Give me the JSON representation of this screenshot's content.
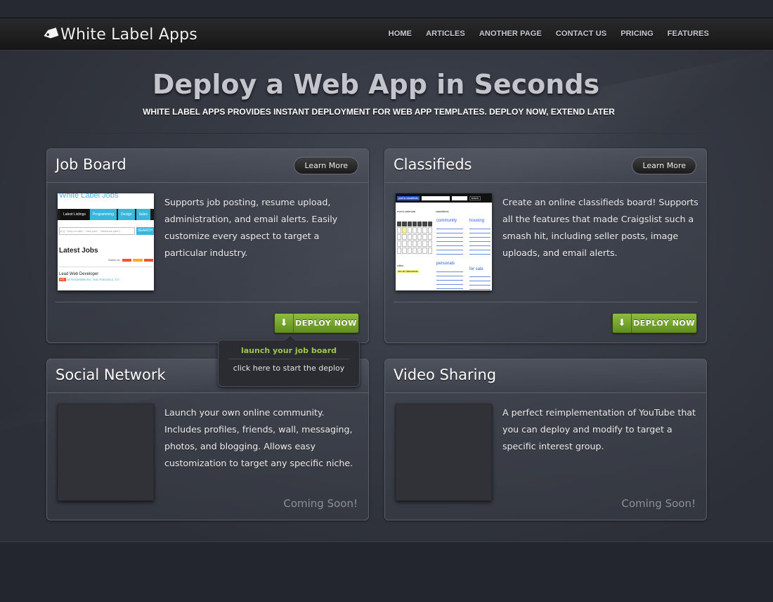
{
  "header": {
    "logo_text": "White Label Apps",
    "nav": [
      "HOME",
      "ARTICLES",
      "ANOTHER PAGE",
      "CONTACT US",
      "PRICING",
      "FEATURES"
    ]
  },
  "hero": {
    "title": "Deploy a Web App in Seconds",
    "subtitle": "WHITE LABEL APPS PROVIDES INSTANT DEPLOYMENT FOR WEB APP TEMPLATES. DEPLOY NOW, EXTEND LATER"
  },
  "cards": [
    {
      "title": "Job Board",
      "learn_more": "Learn More",
      "description": "Supports job posting, resume upload, administration, and email alerts. Easily customize every aspect to target a particular industry.",
      "deploy_label": "DEPLOY NOW",
      "thumb": {
        "brand": "White Label Jobs",
        "tabs": [
          "Latest Listings",
          "Programming",
          "Design",
          "Sales"
        ],
        "search_placeholder": "(e.g. \"ruby on rails\", \"new york\", \"freelance jobs\")",
        "search_btn": "SEARCH",
        "heading": "Latest Jobs",
        "sort_label": "Switch to:",
        "job_title": "Lead Web Developer",
        "job_company": "at TechieWeb Inc, San Francisco, CA"
      }
    },
    {
      "title": "Classifieds",
      "learn_more": "Learn More",
      "description": "Create an online classifieds board! Supports all the features that made Craigslist such a smash hit, including seller posts, image uploads, and email alerts.",
      "deploy_label": "DEPLOY NOW",
      "thumb": {
        "top_btn": "post to classifieds",
        "search_btn": "search",
        "cal_title": "event calendar",
        "col_title": "classifieds",
        "community": "community",
        "housing": "housing",
        "personals": "personals",
        "forsale": "for sale",
        "cities": "cities",
        "see_all": "see all cities/areas"
      }
    },
    {
      "title": "Social Network",
      "description": "Launch your own online community. Includes profiles, friends, wall, messaging, photos, and blogging. Allows easy customization to target any specific niche.",
      "status": "Coming Soon!"
    },
    {
      "title": "Video Sharing",
      "description": "A perfect reimplementation of YouTube that you can deploy and modify to target a specific interest group.",
      "status": "Coming Soon!"
    }
  ],
  "tooltip": {
    "title": "launch your job board",
    "body": "click here to start the deploy"
  }
}
